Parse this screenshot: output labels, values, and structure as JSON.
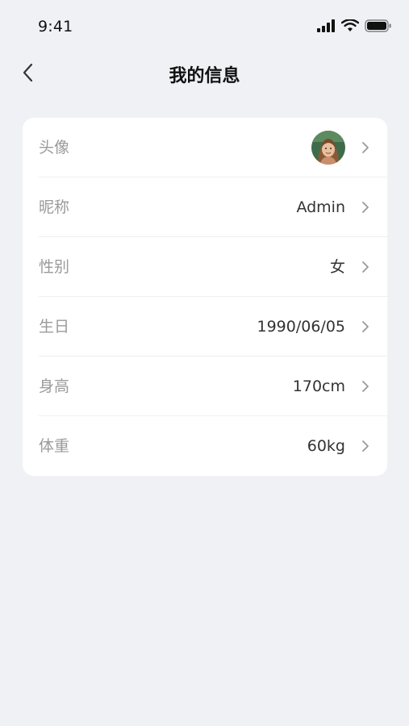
{
  "status_bar": {
    "time": "9:41"
  },
  "nav": {
    "title": "我的信息",
    "back_icon": "chevron-left-icon"
  },
  "profile": {
    "avatar_label": "头像",
    "nickname_label": "昵称",
    "nickname_value": "Admin",
    "gender_label": "性别",
    "gender_value": "女",
    "birthday_label": "生日",
    "birthday_value": "1990/06/05",
    "height_label": "身高",
    "height_value": "170cm",
    "weight_label": "体重",
    "weight_value": "60kg"
  },
  "colors": {
    "background": "#f0f1f5",
    "card": "#ffffff",
    "label": "#9a9a9a",
    "value": "#333333",
    "chevron": "#9a9a9a"
  }
}
